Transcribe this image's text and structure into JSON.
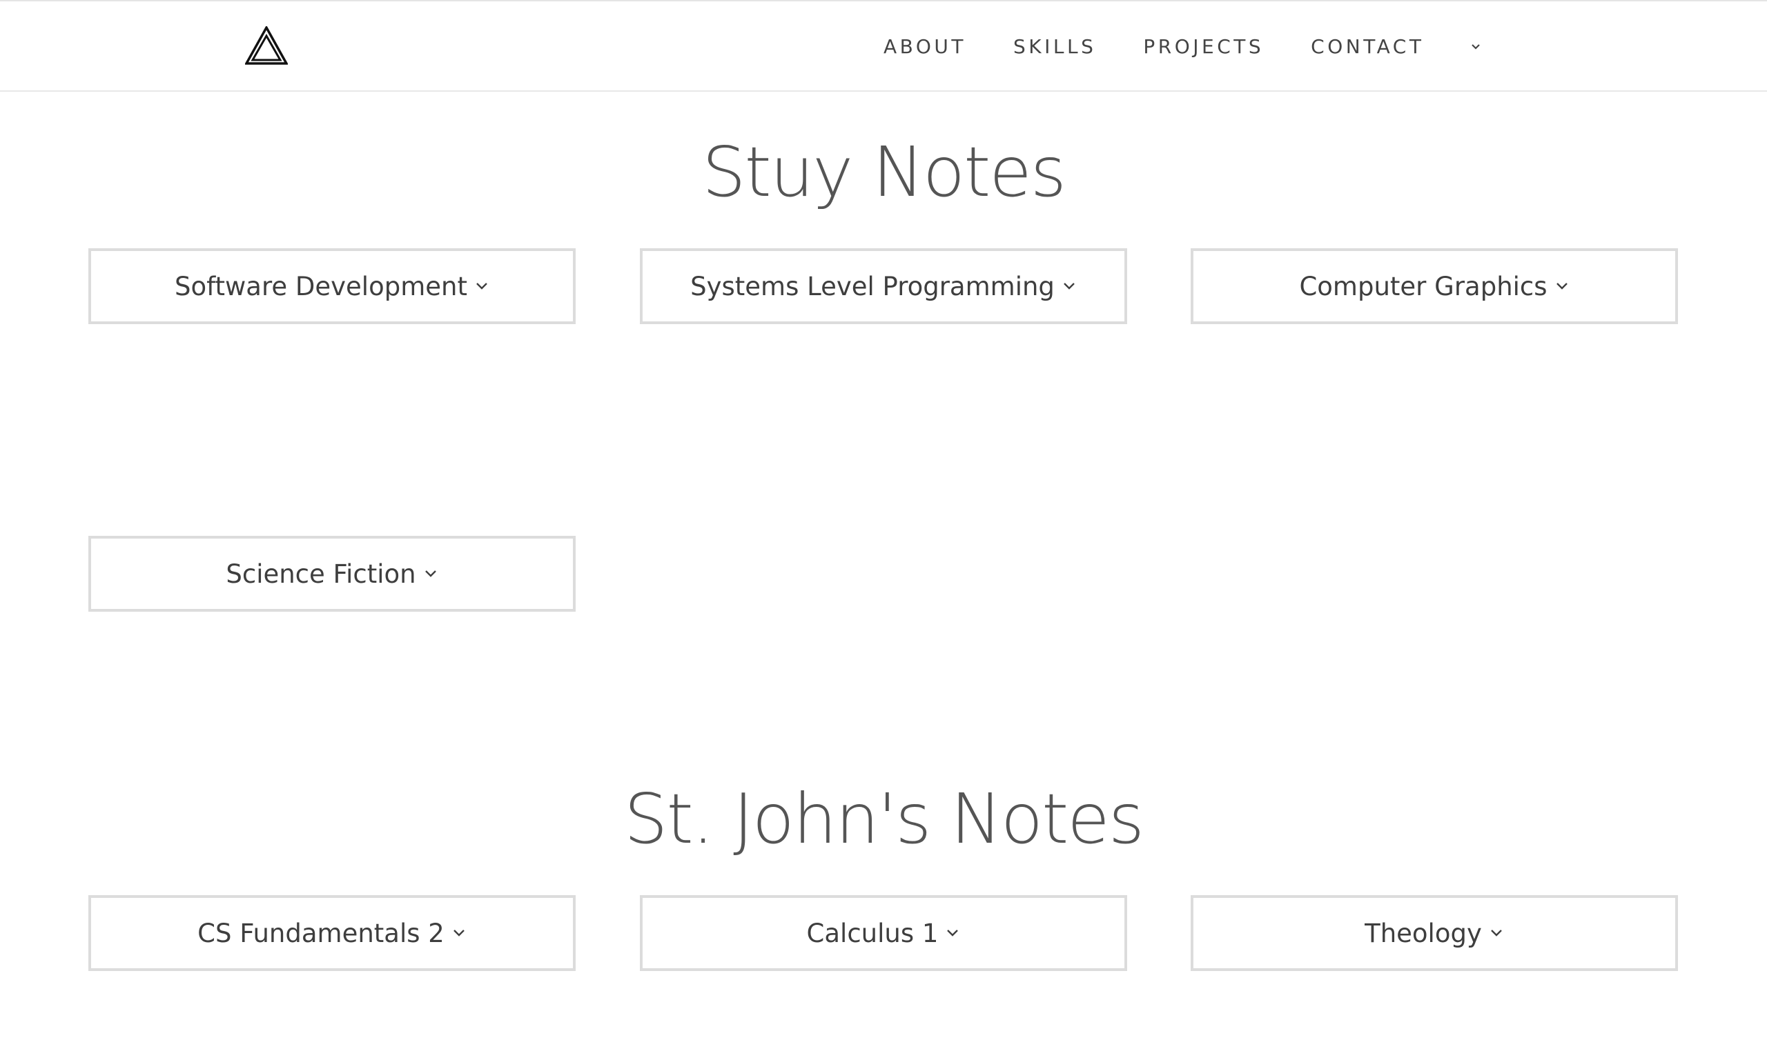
{
  "nav": {
    "links": [
      "ABOUT",
      "SKILLS",
      "PROJECTS",
      "CONTACT"
    ],
    "more_icon": "chevron-down-icon",
    "logo_icon": "triangle-logo-icon"
  },
  "sections": [
    {
      "title": "Stuy Notes",
      "buttons": [
        "Software Development",
        "Systems Level Programming",
        "Computer Graphics",
        "Science Fiction"
      ]
    },
    {
      "title": "St. John's Notes",
      "buttons": [
        "CS Fundamentals 2",
        "Calculus 1",
        "Theology"
      ]
    }
  ],
  "colors": {
    "text": "#555555",
    "border": "#dcdcdc",
    "background": "#ffffff"
  }
}
